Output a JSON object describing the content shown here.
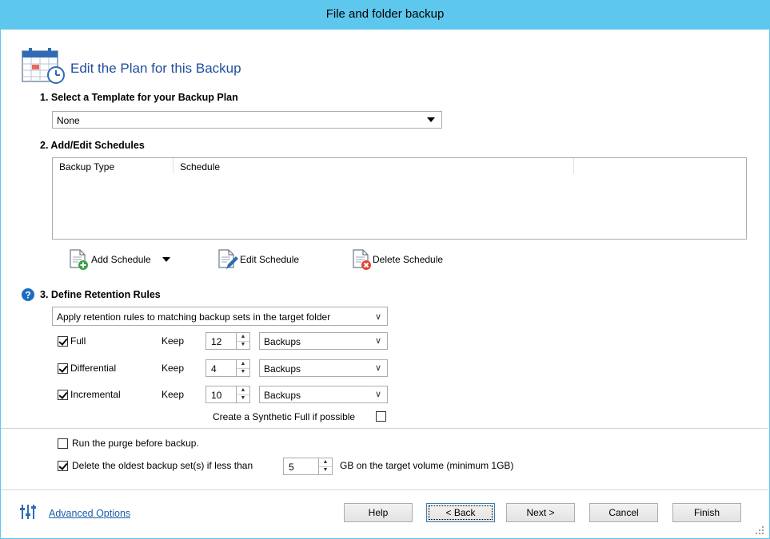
{
  "window": {
    "title": "File and folder backup"
  },
  "header": {
    "title": "Edit the Plan for this Backup"
  },
  "template": {
    "section_label": "1. Select a Template for your Backup Plan",
    "selected": "None"
  },
  "schedules": {
    "section_label": "2. Add/Edit Schedules",
    "columns": [
      "Backup Type",
      "Schedule"
    ],
    "rows": [],
    "add_label": "Add Schedule",
    "edit_label": "Edit Schedule",
    "delete_label": "Delete Schedule"
  },
  "retention": {
    "section_label": "3. Define Retention Rules",
    "mode_selected": "Apply retention rules to matching backup sets in the target folder",
    "keep_label": "Keep",
    "rules": [
      {
        "label": "Full",
        "checked": true,
        "count": "12",
        "unit": "Backups"
      },
      {
        "label": "Differential",
        "checked": true,
        "count": "4",
        "unit": "Backups"
      },
      {
        "label": "Incremental",
        "checked": true,
        "count": "10",
        "unit": "Backups"
      }
    ],
    "synthetic_label": "Create a Synthetic Full if possible",
    "synthetic_checked": false
  },
  "purge": {
    "run_purge_label": "Run the purge before backup.",
    "run_purge_checked": false,
    "delete_oldest_label": "Delete the oldest backup set(s) if less than",
    "delete_oldest_checked": true,
    "delete_oldest_value": "5",
    "delete_oldest_suffix": "GB on the target volume (minimum 1GB)"
  },
  "footer": {
    "advanced_label": "Advanced Options",
    "help_label": "Help",
    "back_label": "< Back",
    "next_label": "Next >",
    "cancel_label": "Cancel",
    "finish_label": "Finish"
  },
  "colors": {
    "titlebar": "#5ec7ee",
    "heading": "#1f4e9e",
    "link": "#1a5ea8",
    "help_icon": "#1a6dbf"
  },
  "icons": [
    "calendar-clock-icon",
    "dropdown-arrow-icon",
    "add-schedule-icon",
    "edit-schedule-icon",
    "delete-schedule-icon",
    "help-icon",
    "sliders-icon"
  ]
}
